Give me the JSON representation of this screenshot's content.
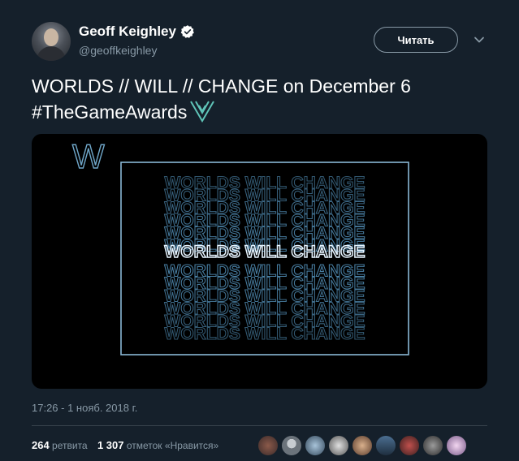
{
  "author": {
    "display_name": "Geoff Keighley",
    "handle": "@geoffkeighley",
    "verified": true,
    "avatar_icon": "profile-photo"
  },
  "follow_button": {
    "label": "Читать"
  },
  "tweet": {
    "text": "WORLDS // WILL // CHANGE on December 6",
    "hashtag": "#TheGameAwards",
    "emoji_icon": "game-awards-logo",
    "timestamp": "17:26 - 1 нояб. 2018 г."
  },
  "media": {
    "corner_letter": "W",
    "repeated_text": "WORLDS WILL CHANGE",
    "highlight_text": "WORLDS WILL CHANGE"
  },
  "stats": {
    "retweets_count": "264",
    "retweets_label": "ретвита",
    "likes_count": "1 307",
    "likes_label": "отметок «Нравится»"
  },
  "likers": [
    "avatar-1",
    "avatar-2",
    "avatar-3",
    "avatar-4",
    "avatar-5",
    "avatar-6",
    "avatar-7",
    "avatar-8",
    "avatar-9"
  ],
  "colors": {
    "background": "#15202b",
    "secondary_text": "#8899a6",
    "accent_teal": "#5fc4b8",
    "verified_blue": "#ffffff"
  }
}
